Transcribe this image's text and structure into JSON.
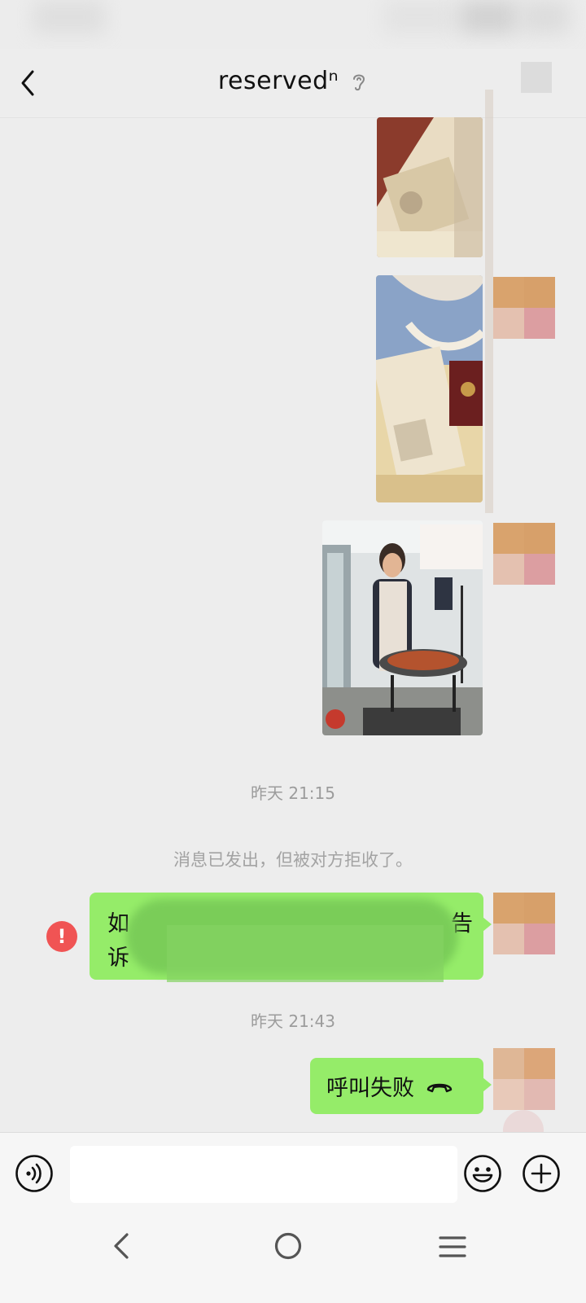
{
  "header": {
    "title": "reservedⁿ"
  },
  "messages": {
    "time_1": "昨天 21:15",
    "system_notice": "消息已发出，但被对方拒收了。",
    "failed_text_fragment_1": "如",
    "failed_text_fragment_2": "告",
    "failed_text_fragment_3": "诉",
    "error_mark": "!",
    "time_2": "昨天 21:43",
    "call_failed": "呼叫失败"
  },
  "icons": {
    "back": "chevron-left-icon",
    "ear": "ear-icon",
    "voice": "voice-icon",
    "emoji": "emoji-icon",
    "plus": "plus-icon",
    "phone": "phone-hangup-icon"
  },
  "colors": {
    "bubble": "#95ec69",
    "error": "#f05454",
    "background": "#ededed"
  }
}
